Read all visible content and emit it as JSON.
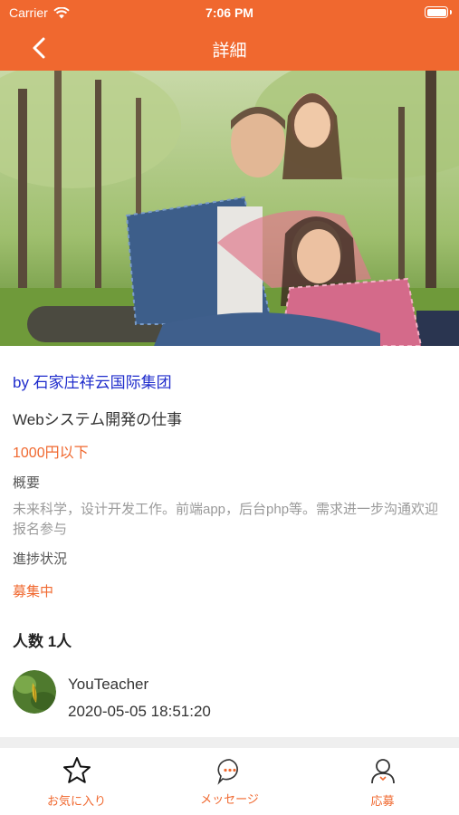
{
  "status_bar": {
    "carrier": "Carrier",
    "time": "7:06 PM"
  },
  "header": {
    "title": "詳細",
    "back_icon": "chevron-left-icon"
  },
  "hero": {
    "image_icon": "family-photo"
  },
  "job": {
    "company": "by 石家庄祥云国际集团",
    "title": "Webシステム開発の仕事",
    "salary": "1000円以下",
    "overview_label": "概要",
    "overview_text": "未来科学，设计开发工作。前端app，后台php等。需求进一步沟通欢迎报名参与",
    "progress_label": "進捗状況",
    "status": "募集中",
    "people_count": "人数 1人"
  },
  "applicant": {
    "name": "YouTeacher",
    "date": "2020-05-05 18:51:20",
    "avatar_icon": "avatar"
  },
  "tabs": [
    {
      "label": "お気に入り",
      "icon": "star-icon"
    },
    {
      "label": "メッセージ",
      "icon": "message-icon"
    },
    {
      "label": "応募",
      "icon": "user-icon"
    }
  ],
  "colors": {
    "accent": "#f0682f",
    "link": "#1f2ccc",
    "muted": "#9a9a9a"
  }
}
